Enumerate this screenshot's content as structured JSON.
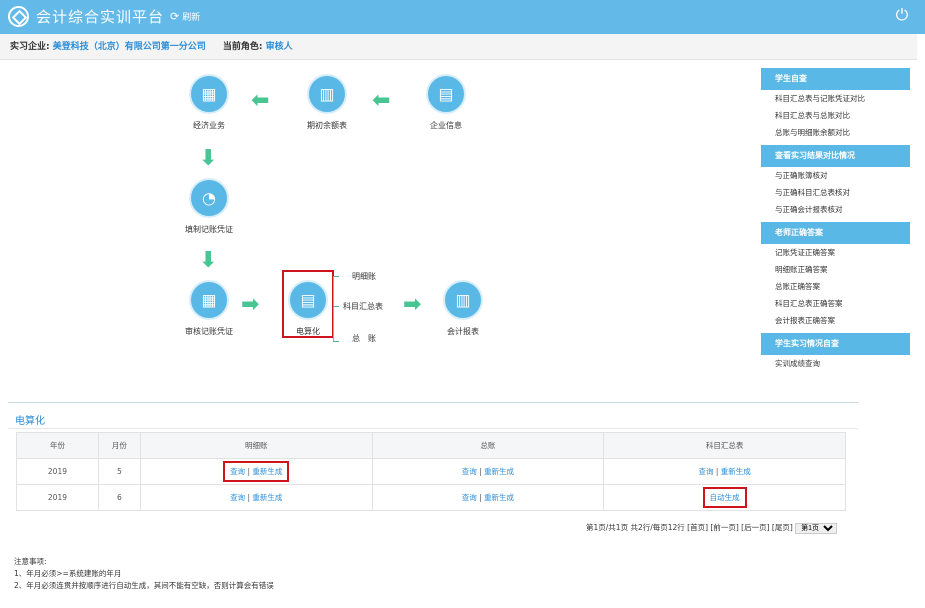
{
  "header": {
    "title": "会计综合实训平台",
    "refresh_label": "刷新"
  },
  "info": {
    "company_label": "实习企业:",
    "company_value": "美登科技（北京）有限公司第一分公司",
    "role_label": "当前角色:",
    "role_value": "审核人"
  },
  "flow": {
    "economic": "经济业务",
    "opening": "期初余额表",
    "company": "企业信息",
    "prepare": "填制记账凭证",
    "review": "审核记账凭证",
    "computer": "电算化",
    "report": "会计报表",
    "branch_detail": "明细账",
    "branch_summary": "科目汇总表",
    "branch_ledger": "总　账"
  },
  "sidebar": {
    "sections": [
      {
        "title": "学生自查",
        "items": [
          "科目汇总表与记账凭证对比",
          "科目汇总表与总账对比",
          "总账与明细账余额对比"
        ]
      },
      {
        "title": "查看实习结果对比情况",
        "items": [
          "与正确账簿核对",
          "与正确科目汇总表核对",
          "与正确会计报表核对"
        ]
      },
      {
        "title": "老师正确答案",
        "items": [
          "记账凭证正确答案",
          "明细账正确答案",
          "总账正确答案",
          "科目汇总表正确答案",
          "会计报表正确答案"
        ]
      },
      {
        "title": "学生实习情况自查",
        "items": [
          "实训成绩查询"
        ]
      }
    ]
  },
  "section": {
    "title": "电算化"
  },
  "table": {
    "headers": [
      "年份",
      "月份",
      "明细账",
      "总账",
      "科目汇总表"
    ],
    "rows": [
      {
        "year": "2019",
        "month": "5",
        "detail_view": "查询",
        "detail_regen": "重新生成",
        "ledger_view": "查询",
        "ledger_regen": "重新生成",
        "summary_view": "查询",
        "summary_regen": "重新生成"
      },
      {
        "year": "2019",
        "month": "6",
        "detail_view": "查询",
        "detail_regen": "重新生成",
        "ledger_view": "查询",
        "ledger_regen": "重新生成",
        "summary_auto": "自动生成"
      }
    ],
    "separator": " | "
  },
  "pager": {
    "text": "第1页/共1页  共2行/每页12行  [首页] [前一页] [后一页] [尾页]",
    "select_value": "第1页"
  },
  "notes": {
    "title": "注意事项:",
    "lines": [
      "1、年月必须>=系统建账的年月",
      "2、年月必须连贯并按顺序进行自动生成，其间不能有空缺，否则计算会有错误"
    ]
  }
}
